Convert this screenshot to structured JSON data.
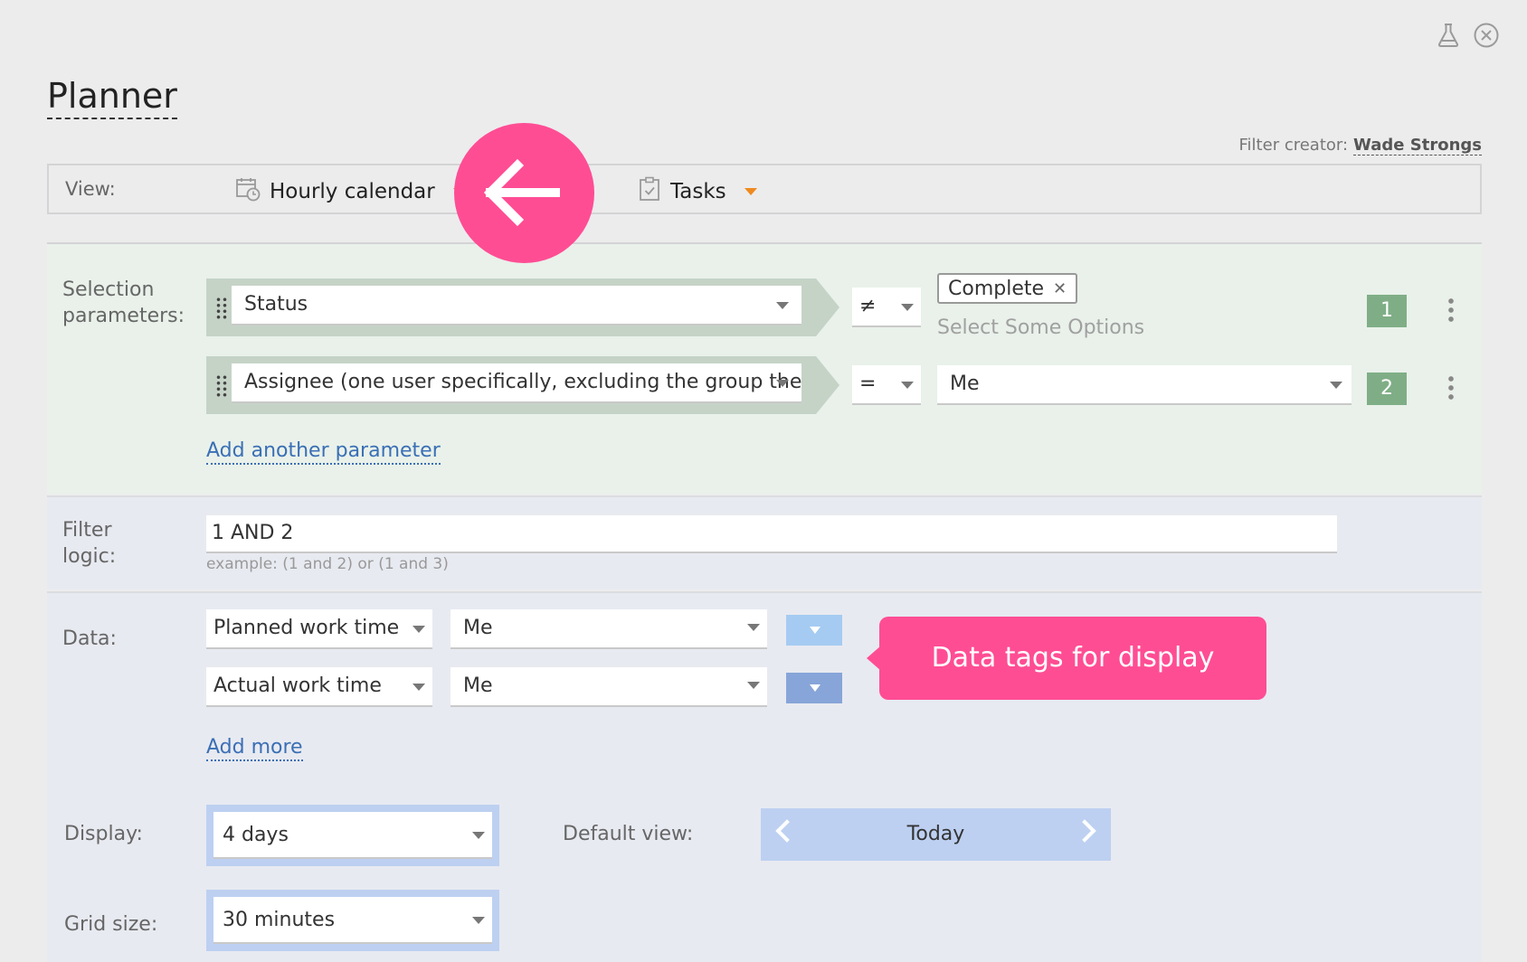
{
  "window": {
    "title": "Planner"
  },
  "header": {
    "filter_creator_label": "Filter creator:",
    "filter_creator_name": "Wade Strongs"
  },
  "view": {
    "label": "View:",
    "primary": "Hourly calendar",
    "secondary": "Tasks"
  },
  "selection": {
    "label_line1": "Selection",
    "label_line2": "parameters:",
    "params": [
      {
        "field": "Status",
        "operator": "≠",
        "tags": [
          "Complete"
        ],
        "placeholder": "Select Some Options",
        "index": "1"
      },
      {
        "field": "Assignee (one user specifically, excluding the group they",
        "operator": "=",
        "value": "Me",
        "index": "2"
      }
    ],
    "add_link": "Add another parameter"
  },
  "logic": {
    "label_line1": "Filter",
    "label_line2": "logic:",
    "value": "1 AND 2",
    "hint": "example: (1 and 2) or (1 and 3)"
  },
  "data": {
    "label": "Data:",
    "rows": [
      {
        "metric": "Planned work time",
        "user": "Me",
        "color": "#a5cbf2"
      },
      {
        "metric": "Actual work time",
        "user": "Me",
        "color": "#87a5d8"
      }
    ],
    "add_link": "Add more",
    "tooltip": "Data tags for display"
  },
  "display": {
    "label": "Display:",
    "value": "4 days",
    "default_view_label": "Default view:",
    "default_view_value": "Today"
  },
  "grid": {
    "label": "Grid size:",
    "value": "30 minutes"
  },
  "colors": {
    "accent_pink": "#ff4d94",
    "badge_green": "#7fae86",
    "link_blue": "#3a6fb5",
    "select_frame": "#bdd0f1",
    "caret_orange": "#ef8a1f"
  }
}
